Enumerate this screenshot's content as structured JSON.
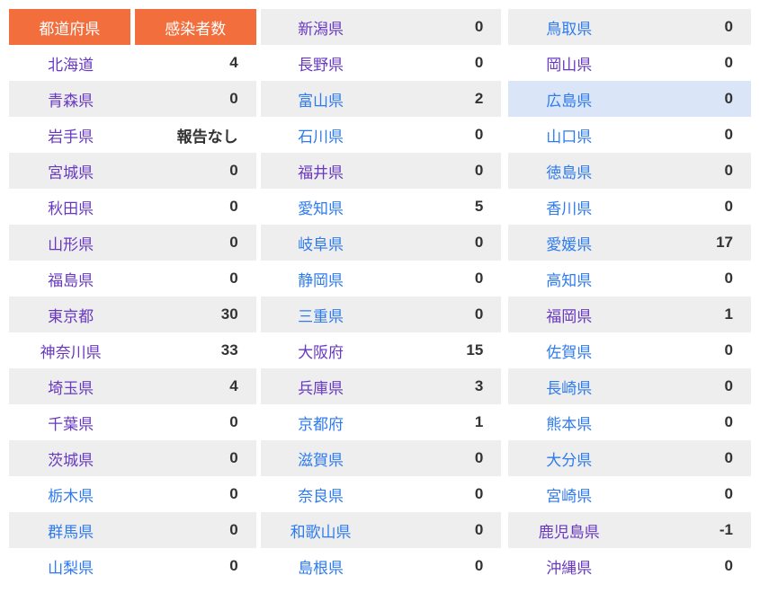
{
  "table_header": {
    "prefecture_label": "都道府県",
    "count_label": "感染者数"
  },
  "colors": {
    "header-bg": "#F26E3C",
    "header-text": "#FFFFFF",
    "row-alt-bg": "#EEEEEE",
    "highlight-row-bg": "#DAE5F7",
    "link-new": "#2E7BEF",
    "link-visited": "#6839C0",
    "count-text": "#333333"
  },
  "tables": [
    {
      "rows": [
        {
          "name": "北海道",
          "value": "4",
          "state": "visited"
        },
        {
          "name": "青森県",
          "value": "0",
          "state": "visited"
        },
        {
          "name": "岩手県",
          "value": "報告なし",
          "state": "visited"
        },
        {
          "name": "宮城県",
          "value": "0",
          "state": "visited"
        },
        {
          "name": "秋田県",
          "value": "0",
          "state": "visited"
        },
        {
          "name": "山形県",
          "value": "0",
          "state": "visited"
        },
        {
          "name": "福島県",
          "value": "0",
          "state": "visited"
        },
        {
          "name": "東京都",
          "value": "30",
          "state": "visited"
        },
        {
          "name": "神奈川県",
          "value": "33",
          "state": "visited"
        },
        {
          "name": "埼玉県",
          "value": "4",
          "state": "visited"
        },
        {
          "name": "千葉県",
          "value": "0",
          "state": "visited"
        },
        {
          "name": "茨城県",
          "value": "0",
          "state": "visited"
        },
        {
          "name": "栃木県",
          "value": "0",
          "state": "new"
        },
        {
          "name": "群馬県",
          "value": "0",
          "state": "new"
        },
        {
          "name": "山梨県",
          "value": "0",
          "state": "new"
        }
      ]
    },
    {
      "rows": [
        {
          "name": "新潟県",
          "value": "0",
          "state": "visited"
        },
        {
          "name": "長野県",
          "value": "0",
          "state": "visited"
        },
        {
          "name": "富山県",
          "value": "2",
          "state": "new"
        },
        {
          "name": "石川県",
          "value": "0",
          "state": "new"
        },
        {
          "name": "福井県",
          "value": "0",
          "state": "visited"
        },
        {
          "name": "愛知県",
          "value": "5",
          "state": "new"
        },
        {
          "name": "岐阜県",
          "value": "0",
          "state": "new"
        },
        {
          "name": "静岡県",
          "value": "0",
          "state": "new"
        },
        {
          "name": "三重県",
          "value": "0",
          "state": "new"
        },
        {
          "name": "大阪府",
          "value": "15",
          "state": "visited"
        },
        {
          "name": "兵庫県",
          "value": "3",
          "state": "visited"
        },
        {
          "name": "京都府",
          "value": "1",
          "state": "new"
        },
        {
          "name": "滋賀県",
          "value": "0",
          "state": "new"
        },
        {
          "name": "奈良県",
          "value": "0",
          "state": "new"
        },
        {
          "name": "和歌山県",
          "value": "0",
          "state": "new"
        },
        {
          "name": "島根県",
          "value": "0",
          "state": "new"
        }
      ]
    },
    {
      "rows": [
        {
          "name": "鳥取県",
          "value": "0",
          "state": "new"
        },
        {
          "name": "岡山県",
          "value": "0",
          "state": "visited"
        },
        {
          "name": "広島県",
          "value": "0",
          "state": "new",
          "highlight": true
        },
        {
          "name": "山口県",
          "value": "0",
          "state": "new"
        },
        {
          "name": "徳島県",
          "value": "0",
          "state": "new"
        },
        {
          "name": "香川県",
          "value": "0",
          "state": "new"
        },
        {
          "name": "愛媛県",
          "value": "17",
          "state": "new"
        },
        {
          "name": "高知県",
          "value": "0",
          "state": "new"
        },
        {
          "name": "福岡県",
          "value": "1",
          "state": "visited"
        },
        {
          "name": "佐賀県",
          "value": "0",
          "state": "new"
        },
        {
          "name": "長崎県",
          "value": "0",
          "state": "new"
        },
        {
          "name": "熊本県",
          "value": "0",
          "state": "new"
        },
        {
          "name": "大分県",
          "value": "0",
          "state": "new"
        },
        {
          "name": "宮崎県",
          "value": "0",
          "state": "new"
        },
        {
          "name": "鹿児島県",
          "value": "-1",
          "state": "visited"
        },
        {
          "name": "沖縄県",
          "value": "0",
          "state": "visited"
        }
      ]
    }
  ]
}
